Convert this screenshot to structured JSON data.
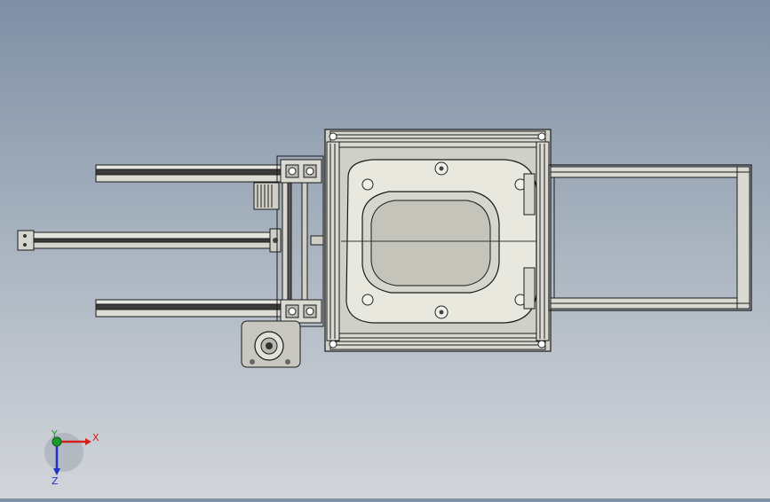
{
  "viewport": {
    "background_top": "#7f8fa4",
    "background_bottom": "#d2d5da"
  },
  "model": {
    "view": "top",
    "frame_color": "#2b2b2b",
    "metal_color": "#c9cbc6",
    "profile_color": "#d8d8d0",
    "mold_color": "#e6e6dc"
  },
  "triad": {
    "x_label": "X",
    "y_label": "Y",
    "z_label": "Z",
    "x_color": "#d42020",
    "y_color": "#1a9a2a",
    "z_color": "#2030c8"
  }
}
